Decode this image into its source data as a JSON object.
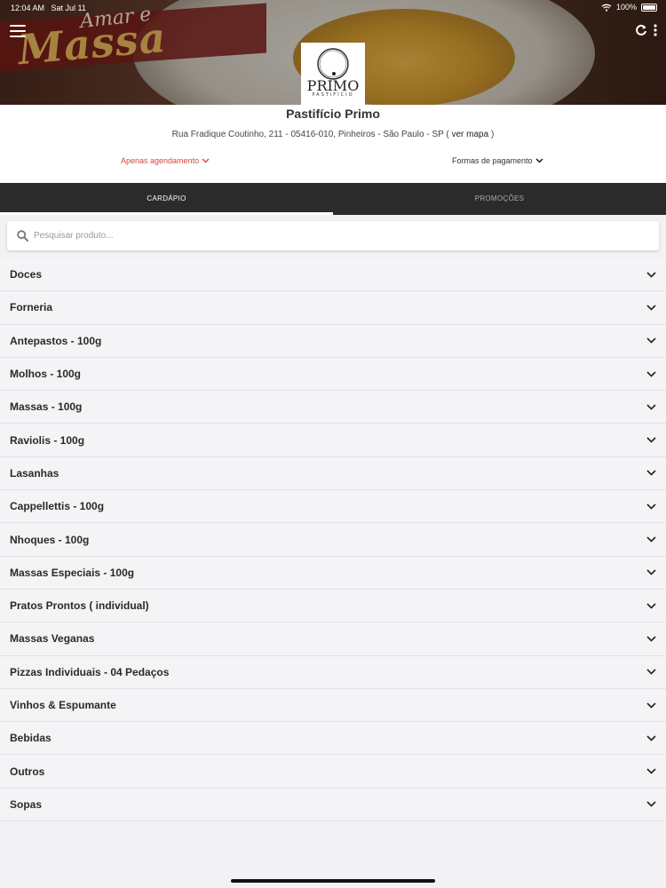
{
  "status_bar": {
    "time": "12:04 AM",
    "date": "Sat Jul 11",
    "battery": "100%"
  },
  "hero": {
    "script_top": "Amar e",
    "script_main": "Massa"
  },
  "logo": {
    "brand": "PRIMO",
    "sub": "PASTIFÍCIO"
  },
  "store": {
    "name": "Pastifício Primo",
    "address": "Rua Fradique Coutinho, 211 - 05416-010, Pinheiros - São Paulo - SP (",
    "map_link": " ver mapa ",
    "address_close": ")"
  },
  "options": {
    "schedule": "Apenas agendamento",
    "payment": "Formas de pagamento"
  },
  "tabs": [
    {
      "label": "CARDÁPIO"
    },
    {
      "label": "PROMOÇÕES"
    }
  ],
  "search": {
    "placeholder": "Pesquisar produto..."
  },
  "categories": [
    {
      "label": "Doces"
    },
    {
      "label": "Forneria"
    },
    {
      "label": "Antepastos - 100g"
    },
    {
      "label": "Molhos - 100g"
    },
    {
      "label": "Massas - 100g"
    },
    {
      "label": "Raviolis - 100g"
    },
    {
      "label": "Lasanhas"
    },
    {
      "label": "Cappellettis - 100g"
    },
    {
      "label": "Nhoques - 100g"
    },
    {
      "label": "Massas Especiais - 100g"
    },
    {
      "label": "Pratos Prontos ( individual)"
    },
    {
      "label": "Massas Veganas"
    },
    {
      "label": "Pizzas Individuais - 04 Pedaços"
    },
    {
      "label": "Vinhos & Espumante"
    },
    {
      "label": "Bebidas"
    },
    {
      "label": "Outros"
    },
    {
      "label": "Sopas"
    }
  ],
  "colors": {
    "accent_red": "#d9463b",
    "tab_bar": "#2b2b2b"
  },
  "icons": [
    "menu-icon",
    "refresh-icon",
    "more-vertical-icon",
    "search-icon",
    "chevron-down-icon",
    "wifi-icon",
    "battery-icon"
  ]
}
